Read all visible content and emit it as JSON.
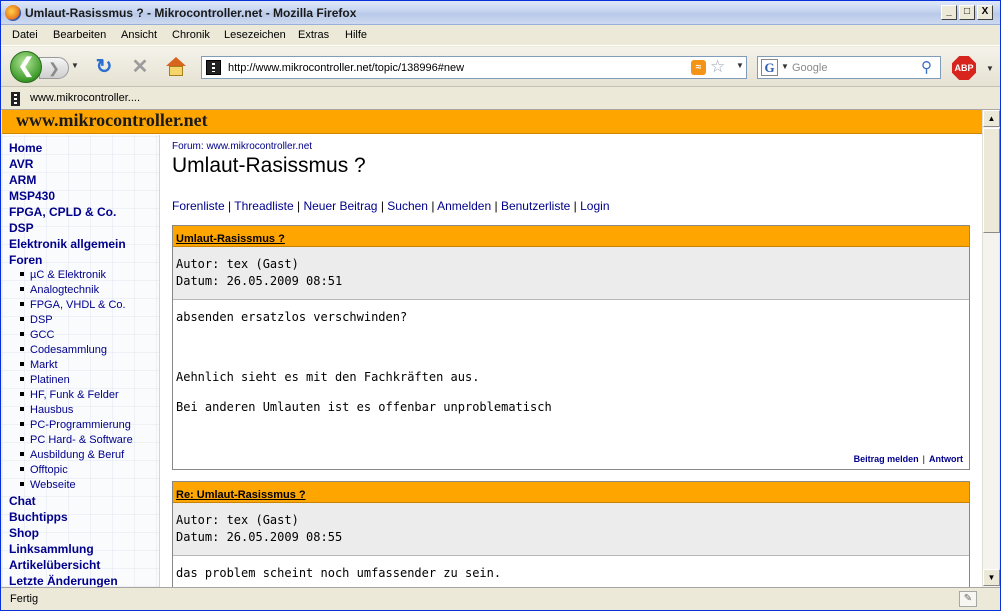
{
  "window": {
    "title": "Umlaut-Rasissmus ? - Mikrocontroller.net - Mozilla Firefox",
    "minimize": "_",
    "maximize": "□",
    "close": "X"
  },
  "menu": [
    "Datei",
    "Bearbeiten",
    "Ansicht",
    "Chronik",
    "Lesezeichen",
    "Extras",
    "Hilfe"
  ],
  "toolbar": {
    "url": "http://www.mikrocontroller.net/topic/138996#new",
    "search_placeholder": "Google",
    "google_glyph": "G",
    "abp_label": "ABP"
  },
  "tab": {
    "label": "www.mikrocontroller...."
  },
  "site": {
    "title": "www.mikrocontroller.net"
  },
  "sidebar": {
    "top": [
      "Home",
      "AVR",
      "ARM",
      "MSP430",
      "FPGA, CPLD & Co.",
      "DSP",
      "Elektronik allgemein",
      "Foren"
    ],
    "forums": [
      "µC & Elektronik",
      "Analogtechnik",
      "FPGA, VHDL & Co.",
      "DSP",
      "GCC",
      "Codesammlung",
      "Markt",
      "Platinen",
      "HF, Funk & Felder",
      "Hausbus",
      "PC-Programmierung",
      "PC Hard- & Software",
      "Ausbildung & Beruf",
      "Offtopic",
      "Webseite"
    ],
    "bottom": [
      "Chat",
      "Buchtipps",
      "Shop",
      "Linksammlung",
      "Artikelübersicht",
      "Letzte Änderungen"
    ]
  },
  "content": {
    "breadcrumb": "Forum: www.mikrocontroller.net",
    "title": "Umlaut-Rasissmus ?",
    "nav": [
      "Forenliste",
      "Threadliste",
      "Neuer Beitrag",
      "Suchen",
      "Anmelden",
      "Benutzerliste",
      "Login"
    ]
  },
  "posts": [
    {
      "title": "Umlaut-Rasissmus ?",
      "author": "Autor: tex (Gast)",
      "date": "Datum: 26.05.2009 08:51",
      "lines": [
        "absenden ersatzlos verschwinden?",
        "",
        "",
        "",
        "Aehnlich sieht es mit den Fachkräften aus.",
        "",
        "Bei anderen Umlauten ist es offenbar unproblematisch"
      ],
      "report": "Beitrag melden",
      "reply": "Antwort"
    },
    {
      "title": "Re: Umlaut-Rasissmus ?",
      "author": "Autor: tex (Gast)",
      "date": "Datum: 26.05.2009 08:55",
      "lines": [
        "das problem scheint noch umfassender zu sein."
      ]
    }
  ],
  "status": {
    "text": "Fertig"
  }
}
